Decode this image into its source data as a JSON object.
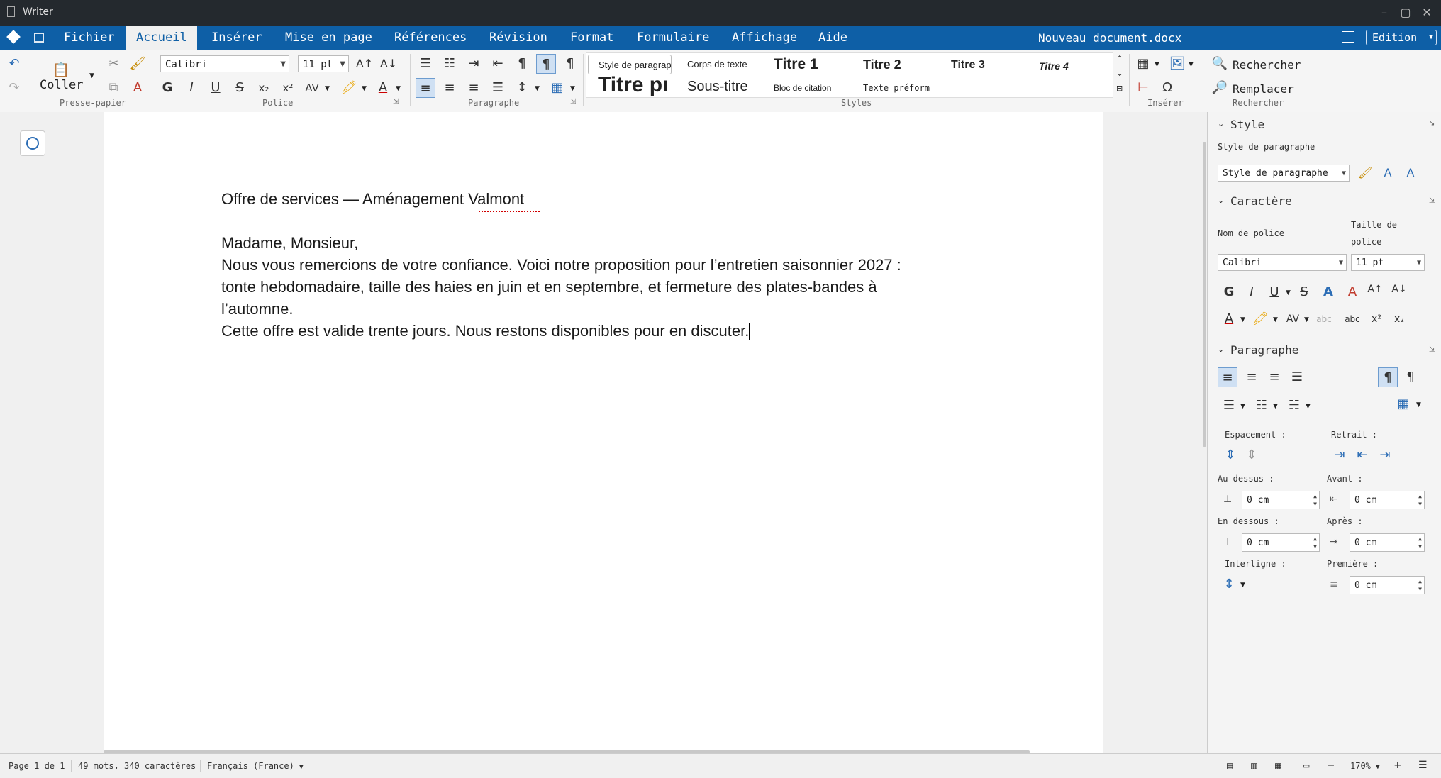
{
  "window": {
    "title": "Writer"
  },
  "menubar": {
    "items": [
      "Fichier",
      "Accueil",
      "Insérer",
      "Mise en page",
      "Références",
      "Révision",
      "Format",
      "Formulaire",
      "Affichage",
      "Aide"
    ],
    "active": "Accueil",
    "doc_name": "Nouveau document.docx",
    "mode": "Edition"
  },
  "ribbon": {
    "clipboard": {
      "paste_label": "Coller",
      "group_label": "Presse-papier"
    },
    "font": {
      "name": "Calibri",
      "size": "11 pt",
      "group_label": "Police",
      "bold": "G",
      "italic": "I",
      "underline": "U",
      "strike": "S",
      "sub": "x₂",
      "sup": "x²",
      "spacing": "AV",
      "color_a": "A"
    },
    "paragraph": {
      "group_label": "Paragraphe"
    },
    "styles": {
      "group_label": "Styles",
      "row1": [
        "Style de paragraphe",
        "Corps de texte",
        "Titre 1",
        "Titre 2",
        "Titre 3",
        "Titre 4"
      ],
      "row2": [
        "Titre principal",
        "Sous-titre",
        "Bloc de citation",
        "Texte préformaté"
      ]
    },
    "insert": {
      "group_label": "Insérer"
    },
    "find": {
      "search": "Rechercher",
      "replace": "Remplacer",
      "group_label": "Rechercher"
    }
  },
  "document": {
    "title_line": "Offre de services — Aménagement Valmont",
    "greeting": "Madame, Monsieur,",
    "body_lines": [
      "Nous vous remercions de votre confiance. Voici notre proposition pour l’entretien saisonnier 2027 :",
      "tonte hebdomadaire, taille des haies en juin et en septembre, et fermeture des plates-bandes à",
      "l’automne."
    ],
    "closing": "Cette offre est valide trente jours. Nous restons disponibles pour en discuter."
  },
  "sidebar": {
    "style": {
      "header": "Style",
      "para_style_label": "Style de paragraphe",
      "para_style_value": "Style de paragraphe"
    },
    "character": {
      "header": "Caractère",
      "font_name_label": "Nom de police",
      "font_size_label_1": "Taille de",
      "font_size_label_2": "police",
      "font_value": "Calibri",
      "size_value": "11 pt"
    },
    "paragraph": {
      "header": "Paragraphe",
      "spacing_label": "Espacement :",
      "indent_label": "Retrait :",
      "above_label": "Au-dessus :",
      "before_label": "Avant :",
      "below_label": "En dessous :",
      "after_label": "Après :",
      "line_label": "Interligne :",
      "first_label": "Première :",
      "above_value": "0 cm",
      "before_value": "0 cm",
      "below_value": "0 cm",
      "after_value": "0 cm",
      "first_value": "0 cm"
    }
  },
  "statusbar": {
    "page": "Page 1 de 1",
    "counts": "49 mots, 340 caractères",
    "language": "Français (France)",
    "zoom": "170%"
  },
  "colors": {
    "accent": "#0e5fa6",
    "titlebar": "#24292e",
    "spellcheck": "#d00000"
  }
}
